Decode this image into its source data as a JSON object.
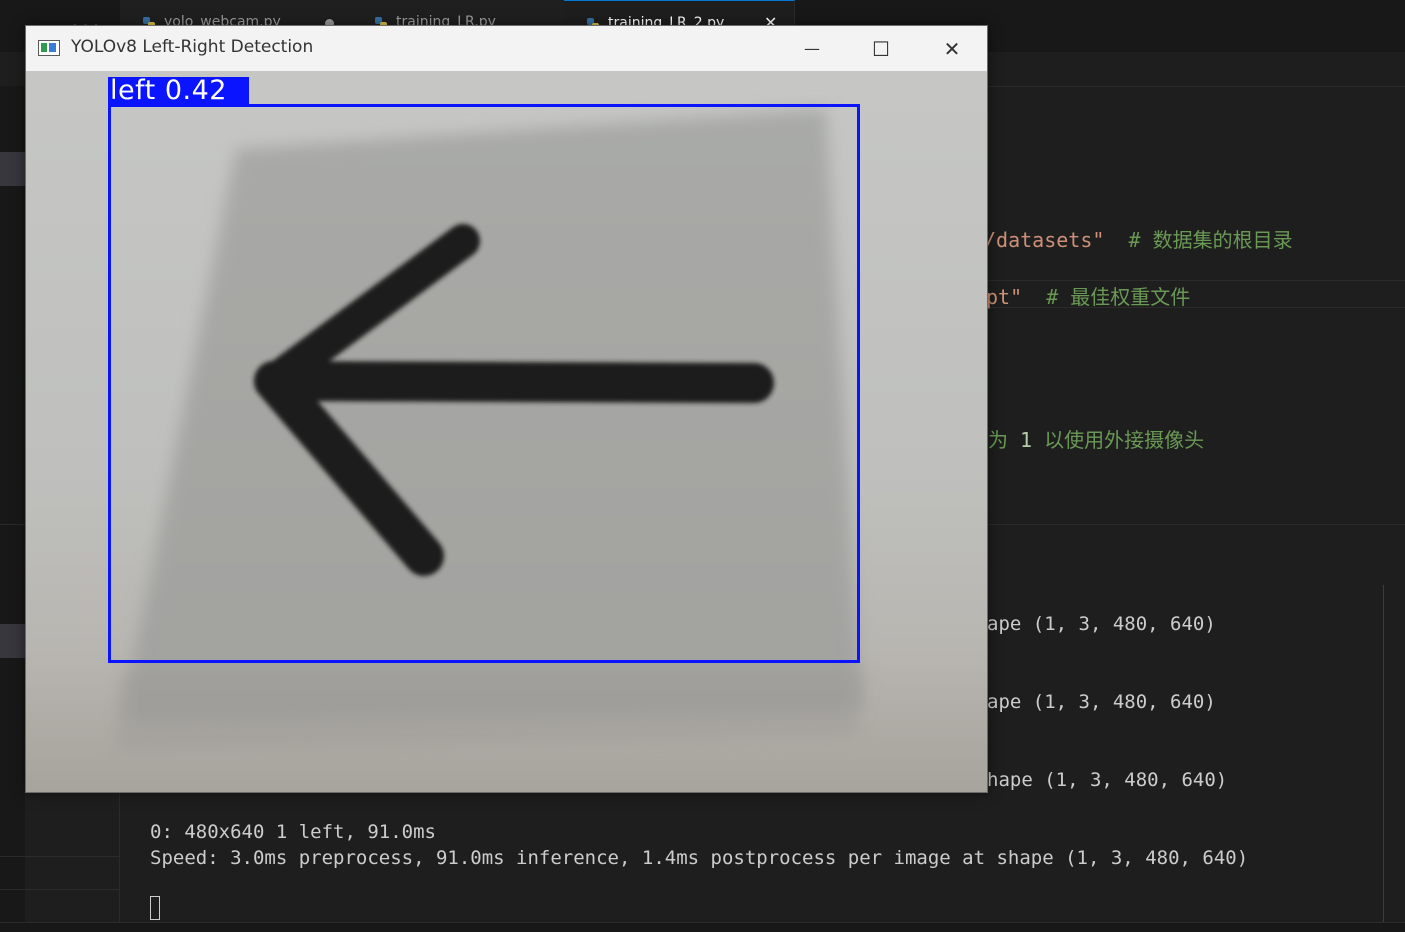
{
  "editor": {
    "tabs": [
      {
        "label": "yolo_webcam.py",
        "dirty": true
      },
      {
        "label": "training_LR.py"
      },
      {
        "label": "training_LR_2.py",
        "active": true
      }
    ],
    "overflow_label": "...",
    "code_fragments": [
      {
        "string": "/datasets\"",
        "comment": "# 数据集的根目录"
      },
      {
        "string": "pt\"",
        "comment": "# 最佳权重文件"
      },
      {
        "text": "为 ",
        "number": "1",
        "comment": " 以使用外接摄像头"
      }
    ]
  },
  "terminal": {
    "partial_lines": [
      "ape (1, 3, 480, 640)",
      "ape (1, 3, 480, 640)",
      "hape (1, 3, 480, 640)"
    ],
    "result_line": "0: 480x640 1 left, 91.0ms",
    "speed_line": "Speed: 3.0ms preprocess, 91.0ms inference, 1.4ms postprocess per image at shape (1, 3, 480, 640)"
  },
  "detection_window": {
    "title": "YOLOv8 Left-Right Detection",
    "controls": {
      "minimize": "—",
      "maximize": "☐",
      "close": "✕"
    },
    "detection": {
      "class": "left",
      "confidence": "0.42",
      "label": "left 0.42",
      "box_color": "#0a14ff"
    }
  },
  "colors": {
    "editor_bg": "#1e1e1e",
    "string": "#ce9178",
    "comment": "#6a9955",
    "number": "#b5cea8",
    "accent": "#0078d4"
  }
}
